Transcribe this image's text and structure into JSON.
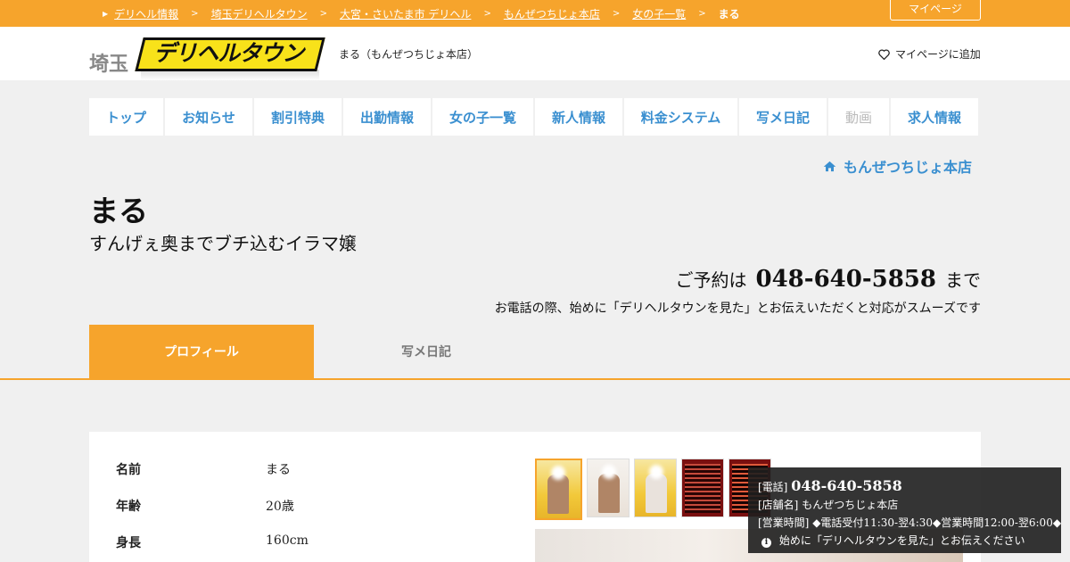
{
  "breadcrumb": {
    "items": [
      "デリヘル情報",
      "埼玉デリヘルタウン",
      "大宮・さいたま市 デリヘル",
      "もんぜつちじょ本店",
      "女の子一覧"
    ],
    "current": "まる",
    "separator": ">"
  },
  "header": {
    "mypage_label": "マイページ",
    "logo_pref": "埼玉",
    "logo_text": "デリヘルタウン",
    "shop_caption": "まる（もんぜつちじょ本店）",
    "add_mypage_label": "マイページに追加"
  },
  "nav": {
    "items": [
      {
        "label": "トップ",
        "enabled": true
      },
      {
        "label": "お知らせ",
        "enabled": true
      },
      {
        "label": "割引特典",
        "enabled": true
      },
      {
        "label": "出勤情報",
        "enabled": true
      },
      {
        "label": "女の子一覧",
        "enabled": true
      },
      {
        "label": "新人情報",
        "enabled": true
      },
      {
        "label": "料金システム",
        "enabled": true
      },
      {
        "label": "写メ日記",
        "enabled": true
      },
      {
        "label": "動画",
        "enabled": false
      },
      {
        "label": "求人情報",
        "enabled": true
      }
    ]
  },
  "shop_link": "もんぜつちじょ本店",
  "girl": {
    "name": "まる",
    "catchphrase": "すんげぇ奥までブチ込むイラマ嬢"
  },
  "reservation": {
    "prefix": "ご予約は",
    "tel": "048-640-5858",
    "suffix": "まで",
    "note": "お電話の際、始めに「デリヘルタウンを見た」とお伝えいただくと対応がスムーズです"
  },
  "tabs": [
    {
      "label": "プロフィール",
      "active": true
    },
    {
      "label": "写メ日記",
      "active": false
    }
  ],
  "profile": [
    {
      "key": "名前",
      "value": "まる"
    },
    {
      "key": "年齢",
      "value": "20歳"
    },
    {
      "key": "身長",
      "value": "160cm"
    }
  ],
  "popup": {
    "tel_label": "[電話]",
    "tel": "048-640-5858",
    "shop_label": "[店舗名]",
    "shop": "もんぜつちじょ本店",
    "hours_label": "[営業時間]",
    "hours": "◆電話受付11:30-翌4:30◆営業時間12:00-翌6:00◆",
    "note": "始めに「デリヘルタウンを見た」とお伝えください"
  },
  "colors": {
    "accent": "#f6a42c",
    "link": "#3a8fd0",
    "popup_bg": "#1e1e1e"
  }
}
